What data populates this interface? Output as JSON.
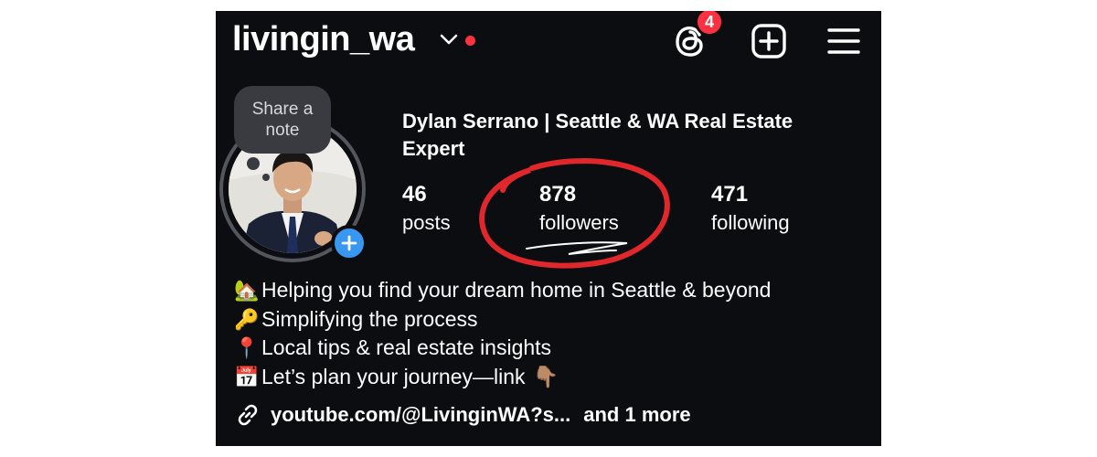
{
  "header": {
    "username": "livingin_wa",
    "notification_count": "4"
  },
  "profile": {
    "note_bubble": "Share a note",
    "full_name": "Dylan Serrano | Seattle & WA Real Estate Expert",
    "stats": {
      "posts_count": "46",
      "posts_label": "posts",
      "followers_count": "878",
      "followers_label": "followers",
      "following_count": "471",
      "following_label": "following"
    },
    "bio": [
      {
        "icon": "🏡",
        "text": "Helping you find your dream home in Seattle & beyond"
      },
      {
        "icon": "🔑",
        "text": "Simplifying the process"
      },
      {
        "icon": "📍",
        "text": "Local tips & real estate insights"
      },
      {
        "icon": "📅",
        "text": "Let’s plan your journey—link",
        "trail": "👇🏽"
      }
    ],
    "link": {
      "url": "youtube.com/@LivinginWA?s...",
      "more": "and 1 more"
    }
  },
  "colors": {
    "background": "#0c0d11",
    "text": "#ffffff",
    "badge": "#ff3040",
    "live_dot": "#ff3040",
    "accent_blue": "#3897f0",
    "annotation": "#e0272b",
    "ring": "#55565c"
  },
  "icons": [
    "chevron-down-icon",
    "threads-icon",
    "new-post-icon",
    "menu-icon",
    "add-story-icon",
    "link-icon"
  ]
}
